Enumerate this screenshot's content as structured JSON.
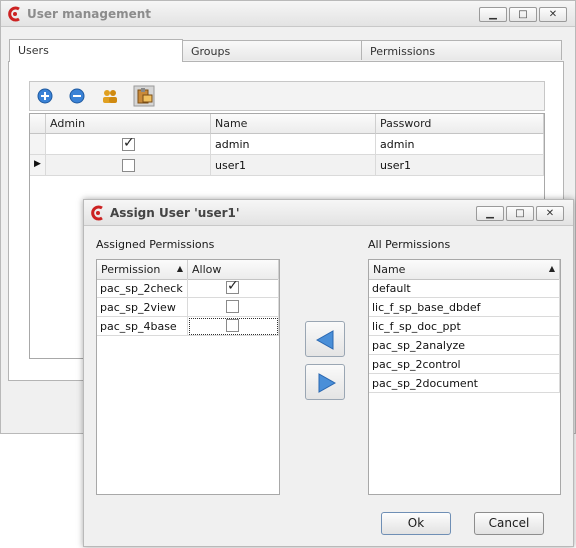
{
  "main_window": {
    "title": "User management",
    "tabs": [
      {
        "label": "Users"
      },
      {
        "label": "Groups"
      },
      {
        "label": "Permissions"
      }
    ],
    "toolbar": {
      "add_icon": "add-user-icon",
      "remove_icon": "remove-user-icon",
      "users_icon": "users-group-icon",
      "clipboard_icon": "clipboard-icon"
    },
    "users_grid": {
      "columns": [
        "Admin",
        "Name",
        "Password"
      ],
      "rows": [
        {
          "admin": true,
          "name": "admin",
          "password": "admin"
        },
        {
          "admin": false,
          "name": "user1",
          "password": "user1"
        }
      ]
    }
  },
  "dialog": {
    "title": "Assign User 'user1'",
    "assigned_label": "Assigned Permissions",
    "all_label": "All Permissions",
    "assigned_grid": {
      "columns": [
        "Permission",
        "Allow"
      ],
      "rows": [
        {
          "permission": "pac_sp_2check",
          "allow": true
        },
        {
          "permission": "pac_sp_2view",
          "allow": false
        },
        {
          "permission": "pac_sp_4base",
          "allow": false
        }
      ]
    },
    "all_grid": {
      "columns": [
        "Name"
      ],
      "rows": [
        "default",
        "lic_f_sp_base_dbdef",
        "lic_f_sp_doc_ppt",
        "pac_sp_2analyze",
        "pac_sp_2control",
        "pac_sp_2document"
      ]
    },
    "ok_label": "Ok",
    "cancel_label": "Cancel"
  },
  "colors": {
    "accent": "#cc2222",
    "arrow": "#4a8fd8",
    "title_text": "#8c8c8c"
  }
}
